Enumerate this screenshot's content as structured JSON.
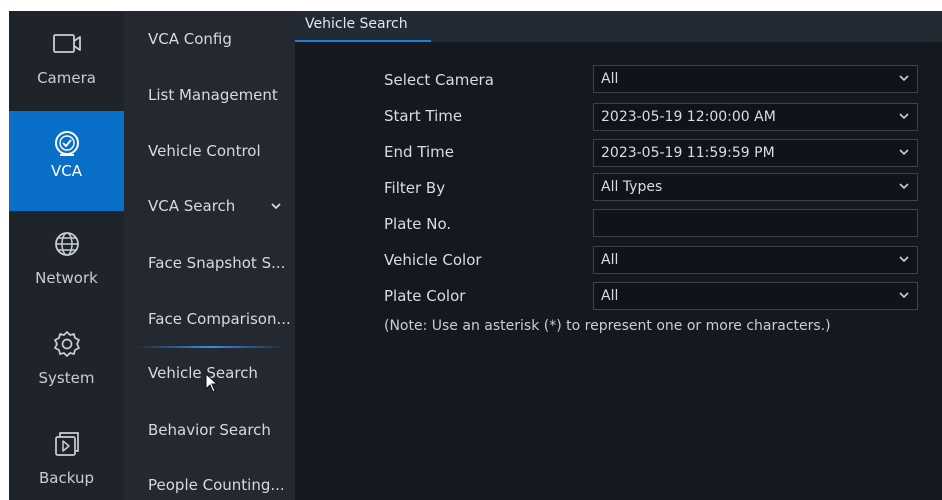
{
  "rail": {
    "items": [
      {
        "label": "Camera",
        "icon": "camera-icon"
      },
      {
        "label": "VCA",
        "icon": "vca-icon",
        "active": true
      },
      {
        "label": "Network",
        "icon": "globe-icon"
      },
      {
        "label": "System",
        "icon": "gear-icon"
      },
      {
        "label": "Backup",
        "icon": "backup-icon"
      }
    ]
  },
  "submenu": {
    "items": [
      {
        "label": "VCA Config"
      },
      {
        "label": "List Management"
      },
      {
        "label": "Vehicle Control"
      },
      {
        "label": "VCA Search"
      },
      {
        "label": "Face Snapshot S..."
      },
      {
        "label": "Face Comparison..."
      },
      {
        "label": "Vehicle Search"
      },
      {
        "label": "Behavior Search"
      },
      {
        "label": "People Counting..."
      }
    ],
    "expand_icon": "chevron-down-icon"
  },
  "tab": {
    "label": "Vehicle Search"
  },
  "form": {
    "select_camera": {
      "label": "Select Camera",
      "value": "All"
    },
    "start_time": {
      "label": "Start Time",
      "value": "2023-05-19 12:00:00 AM"
    },
    "end_time": {
      "label": "End Time",
      "value": "2023-05-19 11:59:59 PM"
    },
    "filter_by": {
      "label": "Filter By",
      "value": "All Types"
    },
    "plate_no": {
      "label": "Plate No.",
      "value": ""
    },
    "vehicle_color": {
      "label": "Vehicle Color",
      "value": "All"
    },
    "plate_color": {
      "label": "Plate Color",
      "value": "All"
    }
  },
  "note": "(Note: Use an asterisk (*) to represent one or more characters.)",
  "colors": {
    "accent": "#0a6fc8",
    "background": "#15191f",
    "rail": "#1f242b",
    "submenu": "#232831"
  }
}
